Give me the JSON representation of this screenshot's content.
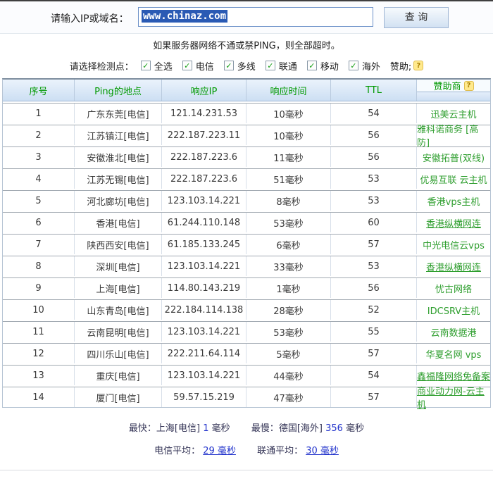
{
  "search": {
    "label": "请输入IP或域名：",
    "input_value": "www.chinaz.com",
    "button_label": "查 询"
  },
  "notice": "如果服务器网络不通或禁PING，则全部超时。",
  "filter": {
    "label": "请选择检测点：",
    "options": [
      "全选",
      "电信",
      "多线",
      "联通",
      "移动",
      "海外"
    ],
    "check_glyph": "✓",
    "sponsor_label": "赞助;",
    "help_icon": "?"
  },
  "table": {
    "headers": [
      "序号",
      "Ping的地点",
      "响应IP",
      "响应时间",
      "TTL",
      "赞助商"
    ],
    "rows": [
      {
        "no": "1",
        "location": "广东东莞[电信]",
        "ip": "121.14.231.53",
        "time": "10毫秒",
        "ttl": "54",
        "sponsor": "迅美云主机",
        "underline": false
      },
      {
        "no": "2",
        "location": "江苏镇江[电信]",
        "ip": "222.187.223.11",
        "time": "10毫秒",
        "ttl": "56",
        "sponsor": "雅科诺商务 [高防]",
        "underline": false
      },
      {
        "no": "3",
        "location": "安徽淮北[电信]",
        "ip": "222.187.223.6",
        "time": "11毫秒",
        "ttl": "56",
        "sponsor": "安徽拓普(双线)",
        "underline": false
      },
      {
        "no": "4",
        "location": "江苏无锡[电信]",
        "ip": "222.187.223.6",
        "time": "51毫秒",
        "ttl": "53",
        "sponsor": "优易互联 云主机",
        "underline": false
      },
      {
        "no": "5",
        "location": "河北廊坊[电信]",
        "ip": "123.103.14.221",
        "time": "8毫秒",
        "ttl": "53",
        "sponsor": "香港vps主机",
        "underline": false
      },
      {
        "no": "6",
        "location": "香港[电信]",
        "ip": "61.244.110.148",
        "time": "53毫秒",
        "ttl": "60",
        "sponsor": "香港纵横网连",
        "underline": true
      },
      {
        "no": "7",
        "location": "陕西西安[电信]",
        "ip": "61.185.133.245",
        "time": "6毫秒",
        "ttl": "57",
        "sponsor": "中光电信云vps",
        "underline": false
      },
      {
        "no": "8",
        "location": "深圳[电信]",
        "ip": "123.103.14.221",
        "time": "33毫秒",
        "ttl": "53",
        "sponsor": "香港纵横网连",
        "underline": true
      },
      {
        "no": "9",
        "location": "上海[电信]",
        "ip": "114.80.143.219",
        "time": "1毫秒",
        "ttl": "56",
        "sponsor": "忧古网络",
        "underline": false
      },
      {
        "no": "10",
        "location": "山东青岛[电信]",
        "ip": "222.184.114.138",
        "time": "28毫秒",
        "ttl": "52",
        "sponsor": "IDCSRV主机",
        "underline": false
      },
      {
        "no": "11",
        "location": "云南昆明[电信]",
        "ip": "123.103.14.221",
        "time": "53毫秒",
        "ttl": "55",
        "sponsor": "云南数据港",
        "underline": false
      },
      {
        "no": "12",
        "location": "四川乐山[电信]",
        "ip": "222.211.64.114",
        "time": "5毫秒",
        "ttl": "57",
        "sponsor": "华夏名网 vps",
        "underline": false
      },
      {
        "no": "13",
        "location": "重庆[电信]",
        "ip": "123.103.14.221",
        "time": "44毫秒",
        "ttl": "54",
        "sponsor": "鑫福隆网络免备案",
        "underline": true
      },
      {
        "no": "14",
        "location": "厦门[电信]",
        "ip": "59.57.15.219",
        "time": "47毫秒",
        "ttl": "57",
        "sponsor": "商业动力网-云主机",
        "underline": true
      }
    ]
  },
  "summary": {
    "fastest_label": "最快：",
    "fastest_loc": "上海[电信]",
    "fastest_value": "1",
    "fastest_unit": "毫秒",
    "slowest_label": "最慢：",
    "slowest_loc": "德国[海外]",
    "slowest_value": "356",
    "slowest_unit": "毫秒",
    "telecom_avg_label": "电信平均：",
    "telecom_avg_value": "29 毫秒",
    "unicom_avg_label": "联通平均：",
    "unicom_avg_value": "30 毫秒"
  },
  "colors": {
    "header_text_green": "#009900",
    "sponsor_link_green": "#2e9e2e",
    "value_blue": "#2233cc",
    "selection_blue": "#2a5ab4"
  }
}
